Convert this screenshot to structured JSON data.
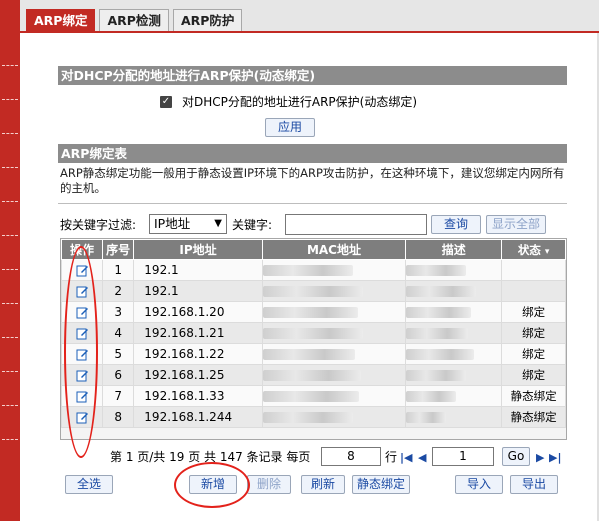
{
  "tabs": [
    {
      "label": "ARP绑定",
      "active": true
    },
    {
      "label": "ARP检测",
      "active": false
    },
    {
      "label": "ARP防护",
      "active": false
    }
  ],
  "dhcp_section": {
    "title": "对DHCP分配的地址进行ARP保护(动态绑定)",
    "checkbox_label": "对DHCP分配的地址进行ARP保护(动态绑定)",
    "checked": true,
    "apply_label": "应用"
  },
  "bind_section": {
    "title": "ARP绑定表",
    "description": "ARP静态绑定功能一般用于静态设置IP环境下的ARP攻击防护，在这种环境下，建议您绑定内网所有的主机。"
  },
  "filter": {
    "label": "按关键字过滤:",
    "select_value": "IP地址",
    "keyword_label": "关键字:",
    "keyword_value": "",
    "search_label": "查询",
    "show_all_label": "显示全部"
  },
  "table": {
    "headers": [
      "操作",
      "序号",
      "IP地址",
      "MAC地址",
      "描述",
      "状态"
    ],
    "rows": [
      {
        "idx": "1",
        "ip": "192.1",
        "status": ""
      },
      {
        "idx": "2",
        "ip": "192.1",
        "status": ""
      },
      {
        "idx": "3",
        "ip": "192.168.1.20",
        "status": "绑定"
      },
      {
        "idx": "4",
        "ip": "192.168.1.21",
        "status": "绑定"
      },
      {
        "idx": "5",
        "ip": "192.168.1.22",
        "status": "绑定"
      },
      {
        "idx": "6",
        "ip": "192.168.1.25",
        "status": "绑定"
      },
      {
        "idx": "7",
        "ip": "192.168.1.33",
        "status": "静态绑定"
      },
      {
        "idx": "8",
        "ip": "192.168.1.244",
        "status": "静态绑定"
      }
    ]
  },
  "pager": {
    "text_before": "第 1 页/共 19 页 共 147 条记录 每页",
    "per_page": "8",
    "row_label": "行",
    "page_value": "1",
    "go_label": "Go"
  },
  "bottom_buttons": {
    "select_all": "全选",
    "add": "新增",
    "delete": "删除",
    "refresh": "刷新",
    "static_bind": "静态绑定",
    "import": "导入",
    "export": "导出"
  },
  "colors": {
    "accent": "#c22a23",
    "section_header": "#8c8c8c",
    "annotation": "#e3221b"
  }
}
